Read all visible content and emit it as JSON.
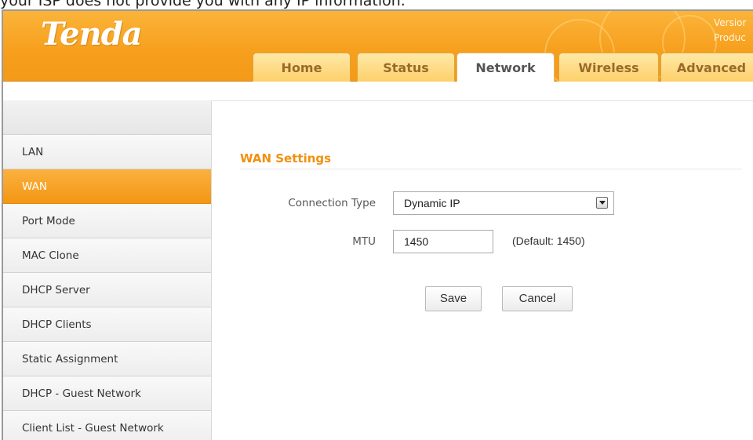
{
  "caption": "your ISP does not provide you with any IP information.",
  "brand": {
    "logo": "Tenda"
  },
  "header_info": {
    "line1": "Versior",
    "line2": "Produc"
  },
  "tabs": [
    {
      "label": "Home"
    },
    {
      "label": "Status"
    },
    {
      "label": "Network"
    },
    {
      "label": "Wireless"
    },
    {
      "label": "Advanced"
    }
  ],
  "active_tab": "Network",
  "sidebar": {
    "items": [
      {
        "label": "LAN"
      },
      {
        "label": "WAN"
      },
      {
        "label": "Port Mode"
      },
      {
        "label": "MAC Clone"
      },
      {
        "label": "DHCP Server"
      },
      {
        "label": "DHCP Clients"
      },
      {
        "label": "Static Assignment"
      },
      {
        "label": "DHCP - Guest Network"
      },
      {
        "label": "Client List - Guest Network"
      }
    ],
    "active_item": "WAN"
  },
  "main": {
    "section_title": "WAN Settings",
    "connection_type": {
      "label": "Connection Type",
      "value": "Dynamic IP"
    },
    "mtu": {
      "label": "MTU",
      "value": "1450",
      "hint": "(Default: 1450)"
    },
    "buttons": {
      "save": "Save",
      "cancel": "Cancel"
    }
  },
  "colors": {
    "brand_orange": "#f7a01e",
    "section_title": "#f0900f",
    "active_sidebar": "#f39612"
  }
}
